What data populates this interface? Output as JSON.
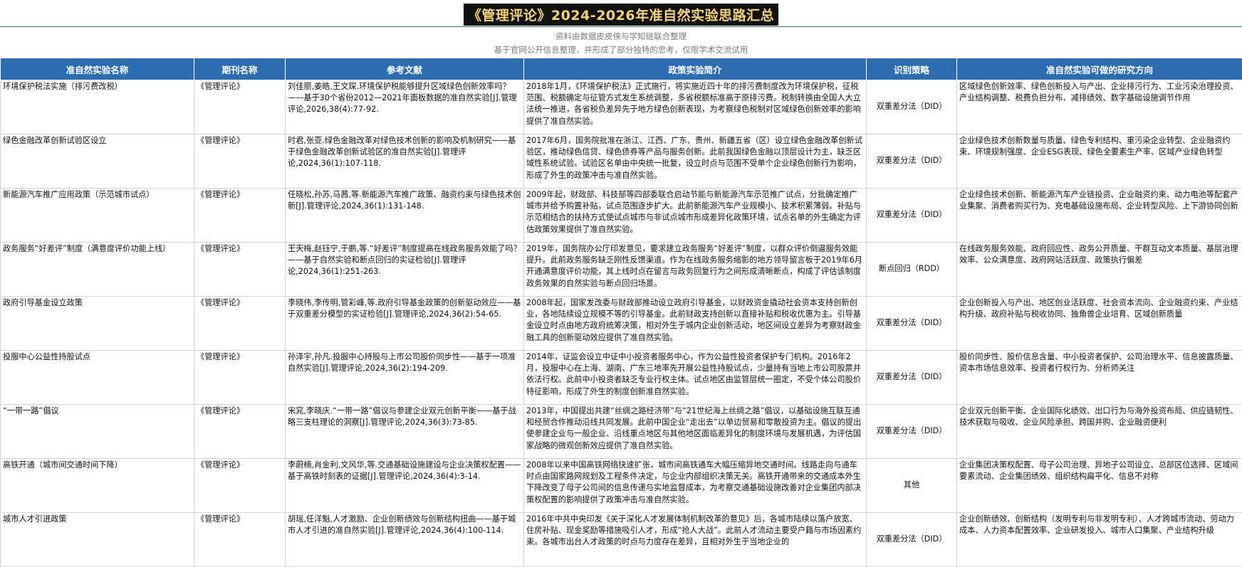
{
  "title": "《管理评论》2024-2026年准自然实验思路汇总",
  "subtitle1": "资料由数据皮皮侠与学知链联合整理",
  "subtitle2": "基于官网公开信息整理，并形成了部分独特的思考，仅限学术交流试用",
  "headers": [
    "准自然实验名称",
    "期刊名称",
    "参考文献",
    "政策实验简介",
    "识别策略",
    "准自然实验可做的研究方向"
  ],
  "rows": [
    {
      "name": "环境保护税法实施（排污费改税）",
      "journal": "《管理评论》",
      "ref": "刘佳丽,姜皓,王文琛.环境保护税能够提升区域绿色创新效率吗？——基于30个省份2012—2021年面板数据的准自然实验[J].管理评论,2026,38(4):77-92.",
      "intro": "2018年1月，《环境保护税法》正式施行，将实施近四十年的排污费制度改为环境保护税，征税范围、税额确定与征管方式发生系统调整，多省税额标准高于原排污费。税制转换由全国人大立法统一推进，各省税负差异先于地方绿色创新表现，为考察绿色税制对区域绿色创新效率的影响提供了准自然实验。",
      "strategy": "双重差分法（DID）",
      "direction": "区域绿色创新效率、绿色创新投入与产出、企业排污行为、工业污染治理投资、产业结构调整、税费负担分布、减排绩效、数字基础设施调节作用"
    },
    {
      "name": "绿色金融改革创新试验区设立",
      "journal": "《管理评论》",
      "ref": "时君,张亚.绿色金融改革对绿色技术创新的影响及机制研究——基于绿色金融改革创新试验区的准自然实验[J].管理评论,2024,36(1):107-118.",
      "intro": "2017年6月，国务院批准在浙江、江西、广东、贵州、新疆五省（区）设立绿色金融改革创新试验区，推动绿色信贷、绿色债券等产品与服务创新。此前我国绿色金融以顶层设计为主，缺乏区域性系统试验。试验区名单由中央统一批复，设立时点与范围不受单个企业绿色创新行为影响，形成了外生的政策冲击与准自然实验。",
      "strategy": "双重差分法（DID）",
      "direction": "企业绿色技术创新数量与质量、绿色专利结构、重污染企业转型、企业融资约束、环境规制强度、企业ESG表现、绿色全要素生产率、区域产业绿色转型"
    },
    {
      "name": "新能源汽车推广应用政策（示范城市试点）",
      "journal": "《管理评论》",
      "ref": "任晓松,孙苏,马茜,等.新能源汽车推广政策、融资约束与绿色技术创新[J].管理评论,2024,36(1):131-148.",
      "intro": "2009年起，财政部、科技部等四部委联合启动节能与新能源汽车示范推广试点，分批确定推广城市并给予购置补贴，试点范围逐步扩大。此前新能源汽车产业规模小、技术积累薄弱。补贴与示范相结合的扶持方式使试点城市与非试点城市形成差异化政策环境，试点名单的外生确定为评估政策效果提供了准自然实验。",
      "strategy": "双重差分法（DID）",
      "direction": "企业绿色技术创新、新能源汽车产业链投资、企业融资约束、动力电池等配套产业集聚、消费者购买行为、充电基础设施布局、企业转型风险、上下游协同创新"
    },
    {
      "name": "政务服务“好差评”制度（满意度评价功能上线）",
      "journal": "《管理评论》",
      "ref": "王天梅,赵钰宁,于鹏,等.“好差评”制度提高在线政务服务效能了吗？——基于自然实验和断点回归的实证检验[J].管理评论,2024,36(1):251-263.",
      "intro": "2019年，国务院办公厅印发意见，要求建立政务服务“好差评”制度，以群众评价倒逼服务效能提升。此前政务服务缺乏刚性反馈渠道。作为在线政务服务缩影的地方领导留言板于2019年6月开通满意度评价功能，其上线时点在留言与政务回复行为之间形成清晰断点，构成了评估该制度政务效果的自然实验与断点回归场景。",
      "strategy": "断点回归（RDD）",
      "direction": "在线政务服务效能、政府回应性、政务公开质量、干群互动文本质量、基层治理效率、公众满意度、政府网站活跃度、政策执行偏差"
    },
    {
      "name": "政府引导基金设立政策",
      "journal": "《管理评论》",
      "ref": "李晓伟,李传明,管彩峰,等.政府引导基金政策的创新驱动效应——基于双重差分模型的实证检验[J].管理评论,2024,36(2):54-65.",
      "intro": "2008年起，国家发改委与财政部推动设立政府引导基金，以财政资金撬动社会资本支持创新创业，各地陆续设立规模不等的引导基金。此前财政支持创新以直接补贴和税收优惠为主。引导基金设立时点由地方政府统筹决策，相对外生于城内企业创新活动，地区间设立差异为考察财政金融工具的创新驱动效应提供了准自然实验。",
      "strategy": "双重差分法（DID）",
      "direction": "企业创新投入与产出、地区创业活跃度、社会资本流向、企业融资约束、产业结构升级、政府补贴与税收协同、独角兽企业培育、区域创新质量"
    },
    {
      "name": "投服中心公益性持股试点",
      "journal": "《管理评论》",
      "ref": "孙泽宇,孙凡.投服中心持股与上市公司股价同步性——基于一项准自然实验[J].管理评论,2024,36(2):194-209.",
      "intro": "2014年，证监会设立中证中小投资者服务中心，作为公益性投资者保护专门机构。2016年2月，投服中心在上海、湖南、广东三地率先开展公益性持股试点，少量持有当地上市公司股票并依法行权。此前中小投资者缺乏专业行权主体。试点地区由监管层统一圈定，不受个体公司股价特征影响，形成了外生的制度创新准自然实验。",
      "strategy": "双重差分法（DID）",
      "direction": "股价同步性、股价信息含量、中小投资者保护、公司治理水平、信息披露质量、资本市场信息效率、投资者行权行为、分析师关注"
    },
    {
      "name": "“一带一路”倡议",
      "journal": "《管理评论》",
      "ref": "宋窕,李晓庆.“一带一路”倡议与参建企业双元创新平衡——基于战略三支柱理论的洞察[J].管理评论,2024,36(3):73-85.",
      "intro": "2013年，中国提出共建“丝绸之路经济带”与“21世纪海上丝绸之路”倡议，以基础设施互联互通和经贸合作推动沿线共同发展。此前中国企业“走出去”以单边贸易和零散投资为主。倡议的提出使参建企业与一般企业、沿线重点地区与其他地区面临差异化的制度环境与发展机遇，为评估国家战略的微观创新效应提供了准自然实验。",
      "strategy": "双重差分法（DID）",
      "direction": "企业双元创新平衡、企业国际化绩效、出口行为与海外投资布局、供应链韧性、技术获取与吸收、企业风险承担、跨国并购、企业融资便利"
    },
    {
      "name": "高铁开通（城市间交通时间下降）",
      "journal": "《管理评论》",
      "ref": "李蔚楠,肖金利,文风华,等.交通基础设施建设与企业决策权配置——基于高铁时刻表的证据[J].管理评论,2024,36(4):3-14.",
      "intro": "2008年以来中国高铁网络快速扩张，城市间高铁通车大幅压缩异地交通时间。线路走向与通车时点由国家路网规划及工程条件决定，与企业内部组织决策无关。高铁开通带来的交通成本外生下降改变了母子公司间的信息传递与实地监督成本，为考察交通基础设施改善对企业集团内部决策权配置的影响提供了政策冲击与准自然实验。",
      "strategy": "其他",
      "direction": "企业集团决策权配置、母子公司治理、异地子公司设立、总部区位选择、区域间要素流动、企业集团绩效、组织结构扁平化、信息不对称"
    },
    {
      "name": "城市人才引进政策",
      "journal": "《管理评论》",
      "ref": "胡瑶,任洋魁,人才激励、企业创新绩效与创新结构扭曲——基于城市人才引进的准自然实验[J].管理评论,2024,36(4):100-114.",
      "intro": "2016年中共中央印发《关于深化人才发展体制机制改革的意见》后，各城市陆续以落户放宽、住房补贴、现金奖励等措施吸引人才，形成“抢人大战”。此前人才流动主要受户籍与市场因素约束。各城市出台人才政策的时点与力度存在差异，且相对外生于当地企业的",
      "strategy": "双重差分法（DID）",
      "direction": "企业创新绩效、创新结构（发明专利与非发明专利）、人才跨城市流动、劳动力成本、人力资本配置效率、企业研发投入、城市人口集聚、产业结构升级"
    }
  ]
}
